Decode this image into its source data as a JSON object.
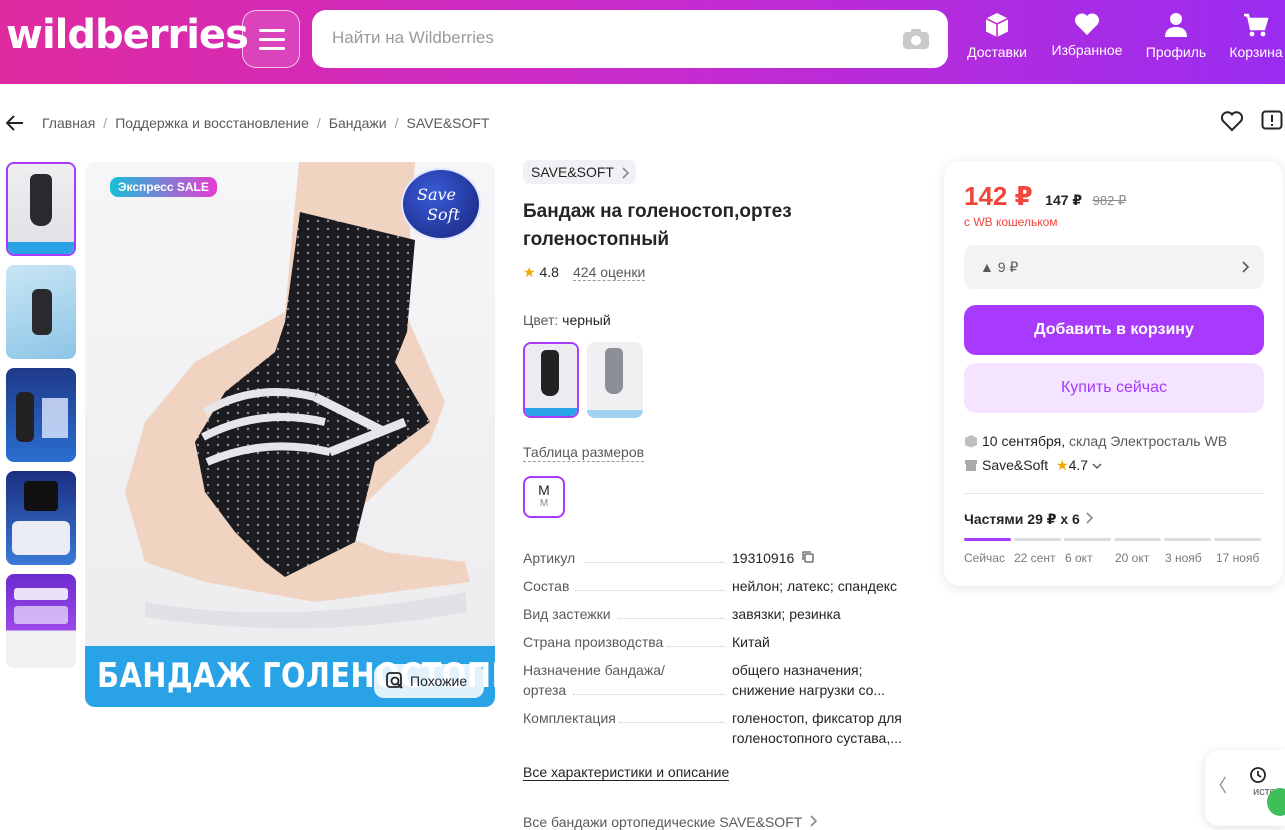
{
  "header": {
    "logo": "wildberries",
    "search_placeholder": "Найти на Wildberries",
    "nav": [
      {
        "label": "Доставки",
        "icon": "box-icon"
      },
      {
        "label": "Избранное",
        "icon": "heart-icon"
      },
      {
        "label": "Профиль",
        "icon": "user-icon"
      },
      {
        "label": "Корзина",
        "icon": "cart-icon"
      }
    ],
    "gradient": [
      "#e02aa0",
      "#9a2cf0"
    ]
  },
  "breadcrumbs": [
    "Главная",
    "Поддержка и восстановление",
    "Бандажи",
    "SAVE&SOFT"
  ],
  "gallery": {
    "badge": "Экспресс SALE",
    "banner_text": "БАНДАЖ ГОЛЕНОСТОПНЫЙ",
    "similar_label": "Похожие"
  },
  "product": {
    "brand": "SAVE&SOFT",
    "title": "Бандаж на голеностоп,ортез голеностопный",
    "rating": "4.8",
    "reviews": "424 оценки",
    "color_label": "Цвет:",
    "color_value": "черный",
    "size_table": "Таблица размеров",
    "size": {
      "main": "M",
      "sub": "M"
    },
    "specs": [
      {
        "k": "Артикул",
        "v": "19310916"
      },
      {
        "k": "Состав",
        "v": "нейлон; латекс; спандекс"
      },
      {
        "k": "Вид застежки",
        "v": "завязки; резинка"
      },
      {
        "k": "Страна производства",
        "v": "Китай"
      },
      {
        "k": "Назначение бандажа/ ортеза",
        "v": "общего назначения; снижение нагрузки со..."
      },
      {
        "k": "Комплектация",
        "v": "голеностоп, фиксатор для голеностопного сустава,..."
      }
    ],
    "all_specs": "Все характеристики и описание",
    "all_brand": "Все бандажи ортопедические SAVE&SOFT"
  },
  "buy": {
    "price": "142 ₽",
    "price_mid": "147 ₽",
    "price_old": "982 ₽",
    "wallet": "с WB кошельком",
    "drop": "▲ 9 ₽",
    "add_to_cart": "Добавить в корзину",
    "buy_now": "Купить сейчас",
    "delivery_date": "10 сентября,",
    "delivery_wh": "склад Электросталь WB",
    "seller": "Save&Soft",
    "seller_rating": "4.7",
    "installments": "Частями 29 ₽ x 6",
    "dates": [
      "Сейчас",
      "22 сент",
      "6 окт",
      "20 окт",
      "3 нояб",
      "17 нояб"
    ],
    "accent": "#a73afd",
    "price_color": "#f0463c"
  },
  "history": {
    "label": "истор"
  }
}
